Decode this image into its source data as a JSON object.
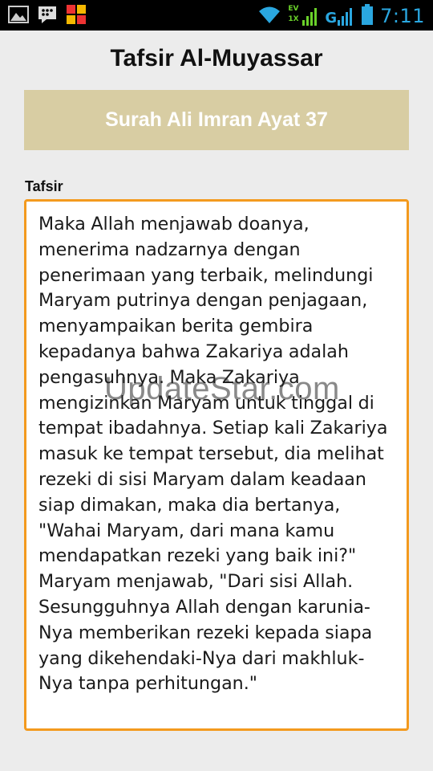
{
  "status_bar": {
    "time": "7:11",
    "network_letter": "G",
    "data_up": "EV",
    "data_down": "1X",
    "left_icons": [
      "gallery-icon",
      "bbm-icon",
      "app-grid-icon"
    ],
    "right_icons": [
      "wifi-icon",
      "signal-1x-icon",
      "signal-g-icon",
      "battery-icon"
    ]
  },
  "header": {
    "title": "Tafsir Al-Muyassar"
  },
  "surah": {
    "label": "Surah Ali Imran Ayat 37"
  },
  "tafsir": {
    "label": "Tafsir",
    "text": "Maka Allah menjawab doanya, menerima nadzarnya dengan penerimaan yang terbaik, melindungi Maryam putrinya dengan penjagaan, menyampaikan berita gembira kepadanya bahwa Zakariya adalah pengasuhnya. Maka Zakariya mengizinkan Maryam untuk tinggal di tempat ibadahnya. Setiap kali Zakariya masuk ke tempat tersebut, dia melihat rezeki di sisi Maryam dalam keadaan siap dimakan, maka dia bertanya, \"Wahai Maryam, dari mana kamu mendapatkan rezeki yang baik ini?\" Maryam menjawab, \"Dari sisi Allah. Sesungguhnya Allah dengan karunia-Nya memberikan rezeki kepada siapa yang dikehendaki-Nya dari makhluk-Nya tanpa perhitungan.\""
  },
  "watermark": {
    "text": "UpdateStar.com"
  },
  "colors": {
    "banner": "#d8cda3",
    "border_accent": "#f39a1e",
    "clock": "#2aa7e0",
    "signal_green": "#6ad12a"
  }
}
